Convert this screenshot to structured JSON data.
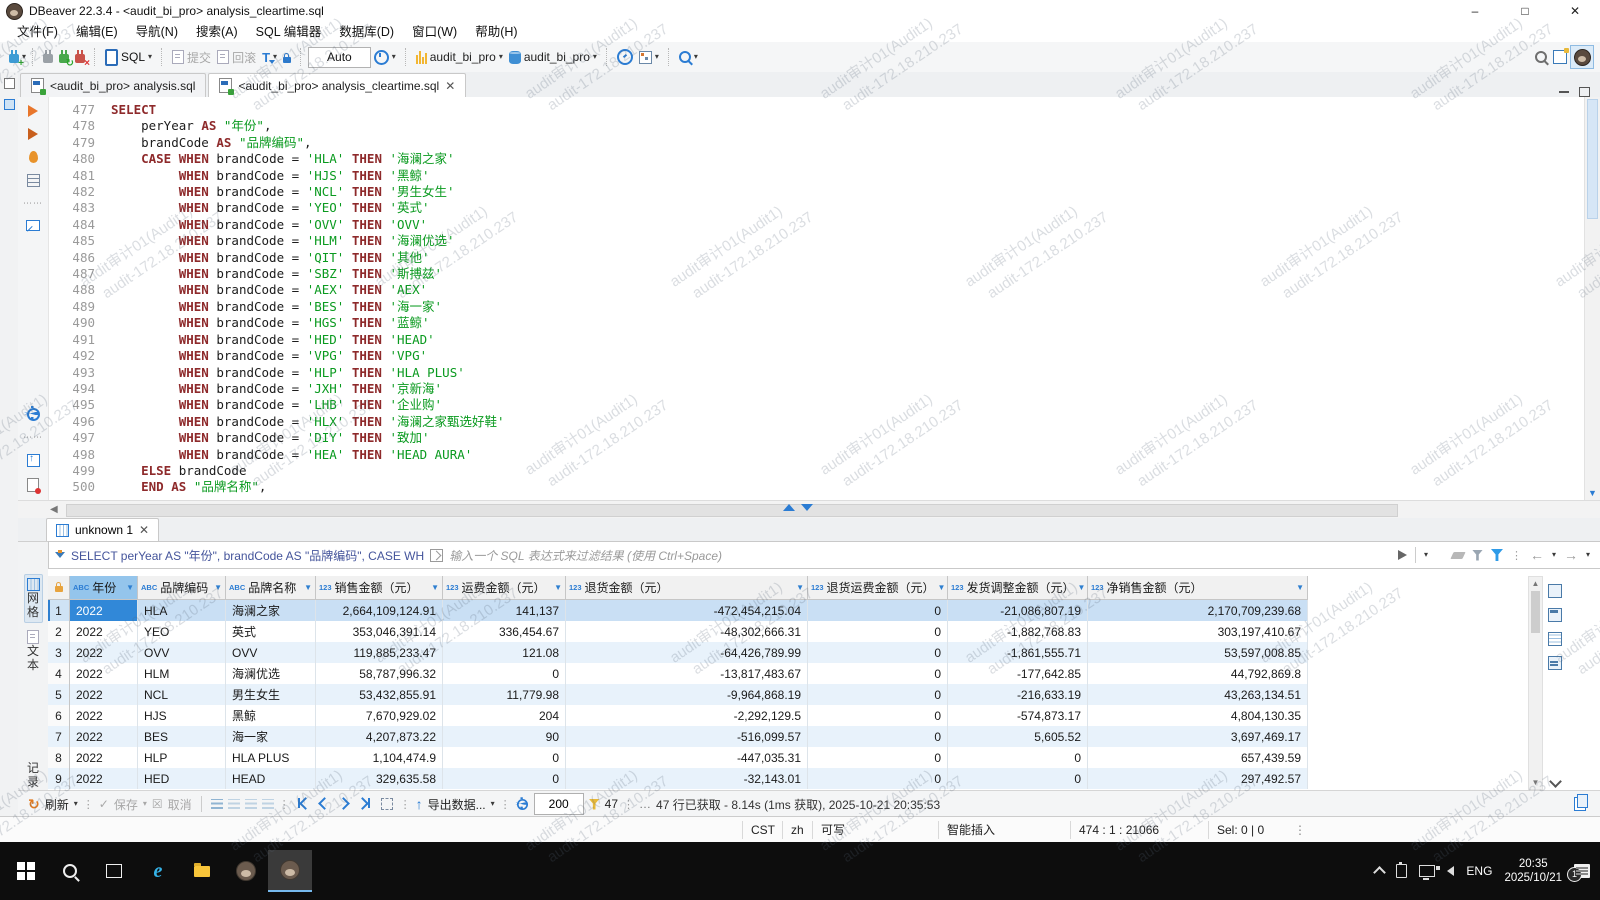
{
  "window": {
    "title": "DBeaver 22.3.4 - <audit_bi_pro> analysis_cleartime.sql"
  },
  "menu": {
    "items": [
      "文件(F)",
      "编辑(E)",
      "导航(N)",
      "搜索(A)",
      "SQL 编辑器",
      "数据库(D)",
      "窗口(W)",
      "帮助(H)"
    ]
  },
  "toolbar": {
    "sql_label": "SQL",
    "commit_label": "提交",
    "rollback_label": "回滚",
    "auto_label": "Auto",
    "connection_db": "audit_bi_pro",
    "connection_schema": "audit_bi_pro"
  },
  "editor_tabs": [
    {
      "label": "<audit_bi_pro> analysis.sql",
      "active": false
    },
    {
      "label": "<audit_bi_pro> analysis_cleartime.sql",
      "active": true
    }
  ],
  "editor": {
    "lines": [
      [
        477,
        [
          [
            "kw",
            "SELECT"
          ]
        ]
      ],
      [
        478,
        [
          [
            "txt",
            "    perYear "
          ],
          [
            "kw",
            "AS"
          ],
          [
            "txt",
            " "
          ],
          [
            "str",
            "\"年份\""
          ],
          [
            "txt",
            ","
          ]
        ]
      ],
      [
        479,
        [
          [
            "txt",
            "    brandCode "
          ],
          [
            "kw",
            "AS"
          ],
          [
            "txt",
            " "
          ],
          [
            "str",
            "\"品牌编码\""
          ],
          [
            "txt",
            ","
          ]
        ]
      ],
      [
        480,
        [
          [
            "txt",
            "    "
          ],
          [
            "kw",
            "CASE"
          ],
          [
            "txt",
            " "
          ],
          [
            "kw",
            "WHEN"
          ],
          [
            "txt",
            " brandCode = "
          ],
          [
            "str",
            "'HLA'"
          ],
          [
            "txt",
            " "
          ],
          [
            "kw",
            "THEN"
          ],
          [
            "txt",
            " "
          ],
          [
            "str",
            "'海澜之家'"
          ]
        ]
      ],
      [
        481,
        [
          [
            "txt",
            "         "
          ],
          [
            "kw",
            "WHEN"
          ],
          [
            "txt",
            " brandCode = "
          ],
          [
            "str",
            "'HJS'"
          ],
          [
            "txt",
            " "
          ],
          [
            "kw",
            "THEN"
          ],
          [
            "txt",
            " "
          ],
          [
            "str",
            "'黑鲸'"
          ]
        ]
      ],
      [
        482,
        [
          [
            "txt",
            "         "
          ],
          [
            "kw",
            "WHEN"
          ],
          [
            "txt",
            " brandCode = "
          ],
          [
            "str",
            "'NCL'"
          ],
          [
            "txt",
            " "
          ],
          [
            "kw",
            "THEN"
          ],
          [
            "txt",
            " "
          ],
          [
            "str",
            "'男生女生'"
          ]
        ]
      ],
      [
        483,
        [
          [
            "txt",
            "         "
          ],
          [
            "kw",
            "WHEN"
          ],
          [
            "txt",
            " brandCode = "
          ],
          [
            "str",
            "'YEO'"
          ],
          [
            "txt",
            " "
          ],
          [
            "kw",
            "THEN"
          ],
          [
            "txt",
            " "
          ],
          [
            "str",
            "'英式'"
          ]
        ]
      ],
      [
        484,
        [
          [
            "txt",
            "         "
          ],
          [
            "kw",
            "WHEN"
          ],
          [
            "txt",
            " brandCode = "
          ],
          [
            "str",
            "'OVV'"
          ],
          [
            "txt",
            " "
          ],
          [
            "kw",
            "THEN"
          ],
          [
            "txt",
            " "
          ],
          [
            "str",
            "'OVV'"
          ]
        ]
      ],
      [
        485,
        [
          [
            "txt",
            "         "
          ],
          [
            "kw",
            "WHEN"
          ],
          [
            "txt",
            " brandCode = "
          ],
          [
            "str",
            "'HLM'"
          ],
          [
            "txt",
            " "
          ],
          [
            "kw",
            "THEN"
          ],
          [
            "txt",
            " "
          ],
          [
            "str",
            "'海澜优选'"
          ]
        ]
      ],
      [
        486,
        [
          [
            "txt",
            "         "
          ],
          [
            "kw",
            "WHEN"
          ],
          [
            "txt",
            " brandCode = "
          ],
          [
            "str",
            "'QIT'"
          ],
          [
            "txt",
            " "
          ],
          [
            "kw",
            "THEN"
          ],
          [
            "txt",
            " "
          ],
          [
            "str",
            "'其他'"
          ]
        ]
      ],
      [
        487,
        [
          [
            "txt",
            "         "
          ],
          [
            "kw",
            "WHEN"
          ],
          [
            "txt",
            " brandCode = "
          ],
          [
            "str",
            "'SBZ'"
          ],
          [
            "txt",
            " "
          ],
          [
            "kw",
            "THEN"
          ],
          [
            "txt",
            " "
          ],
          [
            "str",
            "'斯搏兹'"
          ]
        ]
      ],
      [
        488,
        [
          [
            "txt",
            "         "
          ],
          [
            "kw",
            "WHEN"
          ],
          [
            "txt",
            " brandCode = "
          ],
          [
            "str",
            "'AEX'"
          ],
          [
            "txt",
            " "
          ],
          [
            "kw",
            "THEN"
          ],
          [
            "txt",
            " "
          ],
          [
            "str",
            "'AEX'"
          ]
        ]
      ],
      [
        489,
        [
          [
            "txt",
            "         "
          ],
          [
            "kw",
            "WHEN"
          ],
          [
            "txt",
            " brandCode = "
          ],
          [
            "str",
            "'BES'"
          ],
          [
            "txt",
            " "
          ],
          [
            "kw",
            "THEN"
          ],
          [
            "txt",
            " "
          ],
          [
            "str",
            "'海一家'"
          ]
        ]
      ],
      [
        490,
        [
          [
            "txt",
            "         "
          ],
          [
            "kw",
            "WHEN"
          ],
          [
            "txt",
            " brandCode = "
          ],
          [
            "str",
            "'HGS'"
          ],
          [
            "txt",
            " "
          ],
          [
            "kw",
            "THEN"
          ],
          [
            "txt",
            " "
          ],
          [
            "str",
            "'蓝鲸'"
          ]
        ]
      ],
      [
        491,
        [
          [
            "txt",
            "         "
          ],
          [
            "kw",
            "WHEN"
          ],
          [
            "txt",
            " brandCode = "
          ],
          [
            "str",
            "'HED'"
          ],
          [
            "txt",
            " "
          ],
          [
            "kw",
            "THEN"
          ],
          [
            "txt",
            " "
          ],
          [
            "str",
            "'HEAD'"
          ]
        ]
      ],
      [
        492,
        [
          [
            "txt",
            "         "
          ],
          [
            "kw",
            "WHEN"
          ],
          [
            "txt",
            " brandCode = "
          ],
          [
            "str",
            "'VPG'"
          ],
          [
            "txt",
            " "
          ],
          [
            "kw",
            "THEN"
          ],
          [
            "txt",
            " "
          ],
          [
            "str",
            "'VPG'"
          ]
        ]
      ],
      [
        493,
        [
          [
            "txt",
            "         "
          ],
          [
            "kw",
            "WHEN"
          ],
          [
            "txt",
            " brandCode = "
          ],
          [
            "str",
            "'HLP'"
          ],
          [
            "txt",
            " "
          ],
          [
            "kw",
            "THEN"
          ],
          [
            "txt",
            " "
          ],
          [
            "str",
            "'HLA PLUS'"
          ]
        ]
      ],
      [
        494,
        [
          [
            "txt",
            "         "
          ],
          [
            "kw",
            "WHEN"
          ],
          [
            "txt",
            " brandCode = "
          ],
          [
            "str",
            "'JXH'"
          ],
          [
            "txt",
            " "
          ],
          [
            "kw",
            "THEN"
          ],
          [
            "txt",
            " "
          ],
          [
            "str",
            "'京新海'"
          ]
        ]
      ],
      [
        495,
        [
          [
            "txt",
            "         "
          ],
          [
            "kw",
            "WHEN"
          ],
          [
            "txt",
            " brandCode = "
          ],
          [
            "str",
            "'LHB'"
          ],
          [
            "txt",
            " "
          ],
          [
            "kw",
            "THEN"
          ],
          [
            "txt",
            " "
          ],
          [
            "str",
            "'企业购'"
          ]
        ]
      ],
      [
        496,
        [
          [
            "txt",
            "         "
          ],
          [
            "kw",
            "WHEN"
          ],
          [
            "txt",
            " brandCode = "
          ],
          [
            "str",
            "'HLX'"
          ],
          [
            "txt",
            " "
          ],
          [
            "kw",
            "THEN"
          ],
          [
            "txt",
            " "
          ],
          [
            "str",
            "'海澜之家甄选好鞋'"
          ]
        ]
      ],
      [
        497,
        [
          [
            "txt",
            "         "
          ],
          [
            "kw",
            "WHEN"
          ],
          [
            "txt",
            " brandCode = "
          ],
          [
            "str",
            "'DIY'"
          ],
          [
            "txt",
            " "
          ],
          [
            "kw",
            "THEN"
          ],
          [
            "txt",
            " "
          ],
          [
            "str",
            "'致加'"
          ]
        ]
      ],
      [
        498,
        [
          [
            "txt",
            "         "
          ],
          [
            "kw",
            "WHEN"
          ],
          [
            "txt",
            " brandCode = "
          ],
          [
            "str",
            "'HEA'"
          ],
          [
            "txt",
            " "
          ],
          [
            "kw",
            "THEN"
          ],
          [
            "txt",
            " "
          ],
          [
            "str",
            "'HEAD AURA'"
          ]
        ]
      ],
      [
        499,
        [
          [
            "txt",
            "    "
          ],
          [
            "kw",
            "ELSE"
          ],
          [
            "txt",
            " brandCode"
          ]
        ]
      ],
      [
        500,
        [
          [
            "txt",
            "    "
          ],
          [
            "kw",
            "END"
          ],
          [
            "txt",
            " "
          ],
          [
            "kw",
            "AS"
          ],
          [
            "txt",
            " "
          ],
          [
            "str",
            "\"品牌名称\""
          ],
          [
            "txt",
            ","
          ]
        ]
      ]
    ]
  },
  "results": {
    "tab_label": "unknown 1",
    "filter_query": "SELECT perYear AS \"年份\", brandCode AS \"品牌编码\", CASE WH",
    "filter_placeholder": "输入一个 SQL 表达式来过滤结果 (使用 Ctrl+Space)",
    "side_tabs": [
      {
        "label": "网格",
        "active": true
      },
      {
        "label": "文本",
        "active": false
      }
    ],
    "record_label": "记录",
    "grid": {
      "columns": [
        {
          "type": "lock",
          "label": ""
        },
        {
          "type": "ABC",
          "label": "年份",
          "hl": true
        },
        {
          "type": "ABC",
          "label": "品牌编码"
        },
        {
          "type": "ABC",
          "label": "品牌名称"
        },
        {
          "type": "123",
          "label": "销售金额（元）"
        },
        {
          "type": "123",
          "label": "运费金额（元）"
        },
        {
          "type": "123",
          "label": "退货金额（元）"
        },
        {
          "type": "123",
          "label": "退货运费金额（元）"
        },
        {
          "type": "123",
          "label": "发货调整金额（元）"
        },
        {
          "type": "123",
          "label": "净销售金额（元）"
        }
      ],
      "rows": [
        [
          "1",
          "2022",
          "HLA",
          "海澜之家",
          "2,664,109,124.91",
          "141,137",
          "-472,454,215.04",
          "0",
          "-21,086,807.19",
          "2,170,709,239.68"
        ],
        [
          "2",
          "2022",
          "YEO",
          "英式",
          "353,046,391.14",
          "336,454.67",
          "-48,302,666.31",
          "0",
          "-1,882,768.83",
          "303,197,410.67"
        ],
        [
          "3",
          "2022",
          "OVV",
          "OVV",
          "119,885,233.47",
          "121.08",
          "-64,426,789.99",
          "0",
          "-1,861,555.71",
          "53,597,008.85"
        ],
        [
          "4",
          "2022",
          "HLM",
          "海澜优选",
          "58,787,996.32",
          "0",
          "-13,817,483.67",
          "0",
          "-177,642.85",
          "44,792,869.8"
        ],
        [
          "5",
          "2022",
          "NCL",
          "男生女生",
          "53,432,855.91",
          "11,779.98",
          "-9,964,868.19",
          "0",
          "-216,633.19",
          "43,263,134.51"
        ],
        [
          "6",
          "2022",
          "HJS",
          "黑鲸",
          "7,670,929.02",
          "204",
          "-2,292,129.5",
          "0",
          "-574,873.17",
          "4,804,130.35"
        ],
        [
          "7",
          "2022",
          "BES",
          "海一家",
          "4,207,873.22",
          "90",
          "-516,099.57",
          "0",
          "5,605.52",
          "3,697,469.17"
        ],
        [
          "8",
          "2022",
          "HLP",
          "HLA PLUS",
          "1,104,474.9",
          "0",
          "-447,035.31",
          "0",
          "0",
          "657,439.59"
        ],
        [
          "9",
          "2022",
          "HED",
          "HEAD",
          "329,635.58",
          "0",
          "-32,143.01",
          "0",
          "0",
          "297,492.57"
        ]
      ]
    },
    "toolbar": {
      "refresh": "刷新",
      "save": "保存",
      "cancel": "取消",
      "export": "导出数据...",
      "page_size": "200",
      "fetch_count": "47",
      "ellipsis": "…",
      "status": "47 行已获取 - 8.14s (1ms 获取), 2025-10-21 20:35:53"
    }
  },
  "statusbar": {
    "segments": [
      "CST",
      "zh",
      "可写",
      "智能插入",
      "474 : 1 : 21066",
      "Sel: 0 | 0"
    ]
  },
  "taskbar": {
    "lang": "ENG",
    "time": "20:35",
    "date": "2025/10/21",
    "badge": "1"
  },
  "watermark": {
    "line1": "audit审计01(Audit1)",
    "line2": "audit-172.18.210.237"
  },
  "colors": {
    "keyword": "#8e2a2b",
    "string": "#0a9a1f",
    "accent": "#2b7cd3",
    "selection": "#3188d8"
  }
}
